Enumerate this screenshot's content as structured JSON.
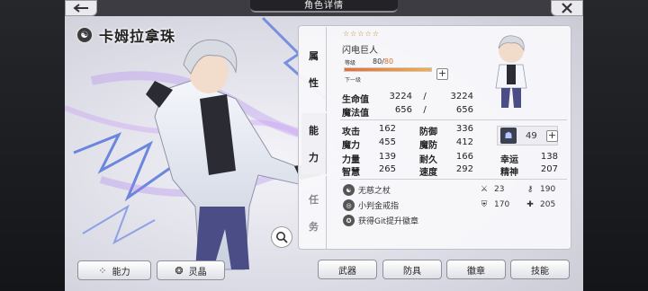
{
  "header": {
    "title": "角色详情"
  },
  "character": {
    "name": "卡姆拉拿珠",
    "stars": "☆☆☆☆☆",
    "job": "闪电巨人",
    "level_label": "等级",
    "level": "80",
    "level_sep": "/",
    "level_max": "80",
    "level_progress_fraction": 1.0,
    "next_label": "下一级"
  },
  "tabs": {
    "attr": [
      "属",
      "性"
    ],
    "ability": [
      "能",
      "力"
    ],
    "job": [
      "任",
      "务"
    ]
  },
  "vitals": [
    {
      "label": "生命值",
      "current": "3224",
      "sep": "/",
      "max": "3224"
    },
    {
      "label": "魔法值",
      "current": "656",
      "sep": "/",
      "max": "656"
    }
  ],
  "stats": [
    {
      "label": "攻击",
      "value": "162"
    },
    {
      "label": "防御",
      "value": "336"
    },
    {
      "label": "魔力",
      "value": "455"
    },
    {
      "label": "魔防",
      "value": "412"
    },
    {
      "label": "力量",
      "value": "139"
    },
    {
      "label": "耐久",
      "value": "166"
    },
    {
      "label": "幸运",
      "value": "138"
    },
    {
      "label": "智慧",
      "value": "265"
    },
    {
      "label": "速度",
      "value": "292"
    },
    {
      "label": "精神",
      "value": "207"
    }
  ],
  "special_stat": {
    "value": "49"
  },
  "equipment": [
    {
      "name": "无慈之杖"
    },
    {
      "name": "小判金戒指"
    },
    {
      "name": "获得Git提升徽章"
    }
  ],
  "equip_stats": {
    "atk": "23",
    "key": "190",
    "def": "170",
    "heal": "205"
  },
  "bottom_left": {
    "ability": "能力",
    "crystal": "灵晶"
  },
  "bottom_right": [
    "武器",
    "防具",
    "徽章",
    "技能"
  ],
  "colors": {
    "accent": "#d86a1f",
    "bar": "#f2b045"
  }
}
